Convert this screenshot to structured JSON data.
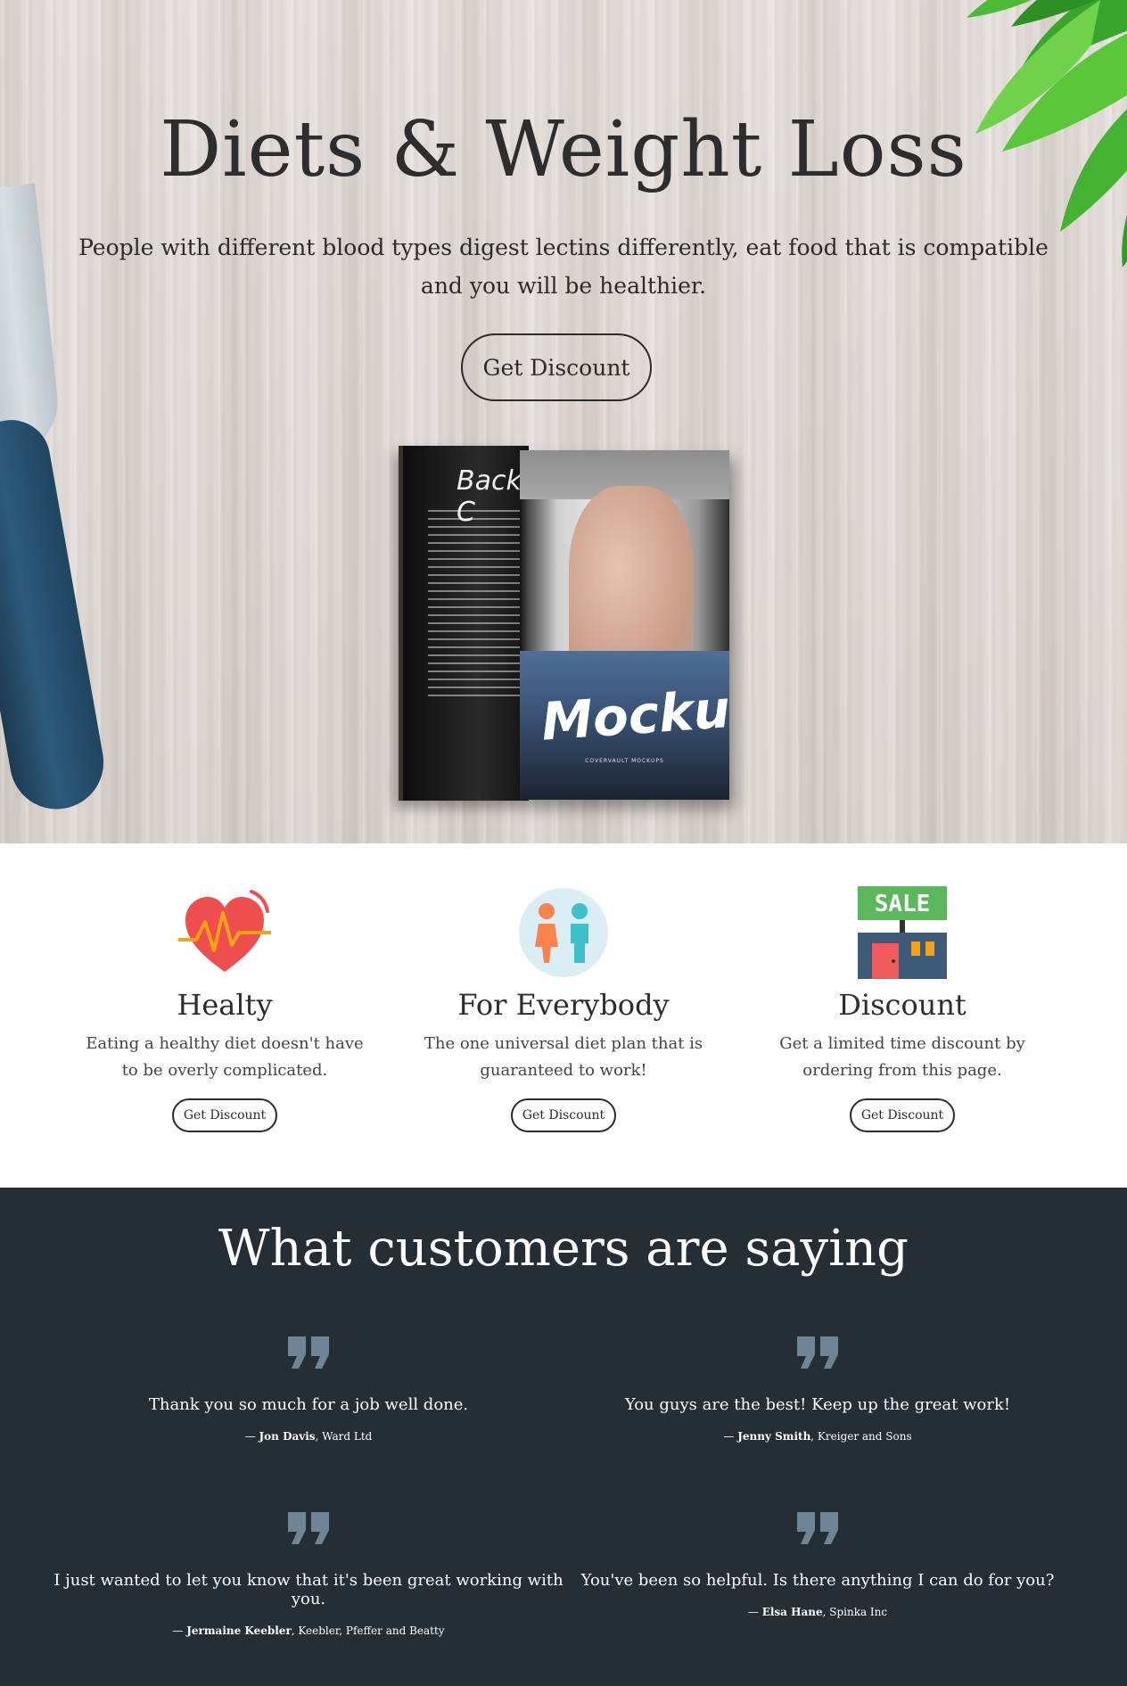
{
  "hero": {
    "title": "Diets & Weight Loss",
    "subtitle": "People with different blood types digest lectins differently, eat food that is compatible and you will be healthier.",
    "cta_label": "Get Discount",
    "book": {
      "back_title": "Back C",
      "front_title": "Mockup",
      "front_subtitle": "COVERVAULT MOCKUPS"
    }
  },
  "features": [
    {
      "icon": "heart-pulse-icon",
      "title": "Healty",
      "text": "Eating a healthy diet doesn't have to be overly complicated.",
      "button": "Get Discount"
    },
    {
      "icon": "people-icon",
      "title": "For Everybody",
      "text": "The one universal diet plan that is guaranteed to work!",
      "button": "Get Discount"
    },
    {
      "icon": "sale-store-icon",
      "title": "Discount",
      "text": "Get a limited time discount by ordering from this page.",
      "button": "Get Discount"
    }
  ],
  "testimonials": {
    "title": "What customers are saying",
    "items": [
      {
        "quote": "Thank you so much for a job well done.",
        "dash": "— ",
        "name": "Jon Davis",
        "company": ", Ward Ltd"
      },
      {
        "quote": "You guys are the best! Keep up the great work!",
        "dash": "— ",
        "name": "Jenny Smith",
        "company": ", Kreiger and Sons"
      },
      {
        "quote": "I just wanted to let you know that it's been great working with you.",
        "dash": "— ",
        "name": "Jermaine Keebler",
        "company": ", Keebler, Pfeffer and Beatty"
      },
      {
        "quote": "You've been so helpful. Is there anything I can do for you?",
        "dash": "— ",
        "name": "Elsa Hane",
        "company": ", Spinka Inc"
      }
    ]
  },
  "colors": {
    "dark_section": "#252e35",
    "quote_mark": "#6f8595",
    "heart": "#ef4e4e",
    "pulse": "#f7a21b",
    "sale_green": "#5cb85c",
    "store_blue": "#3d5a78"
  }
}
